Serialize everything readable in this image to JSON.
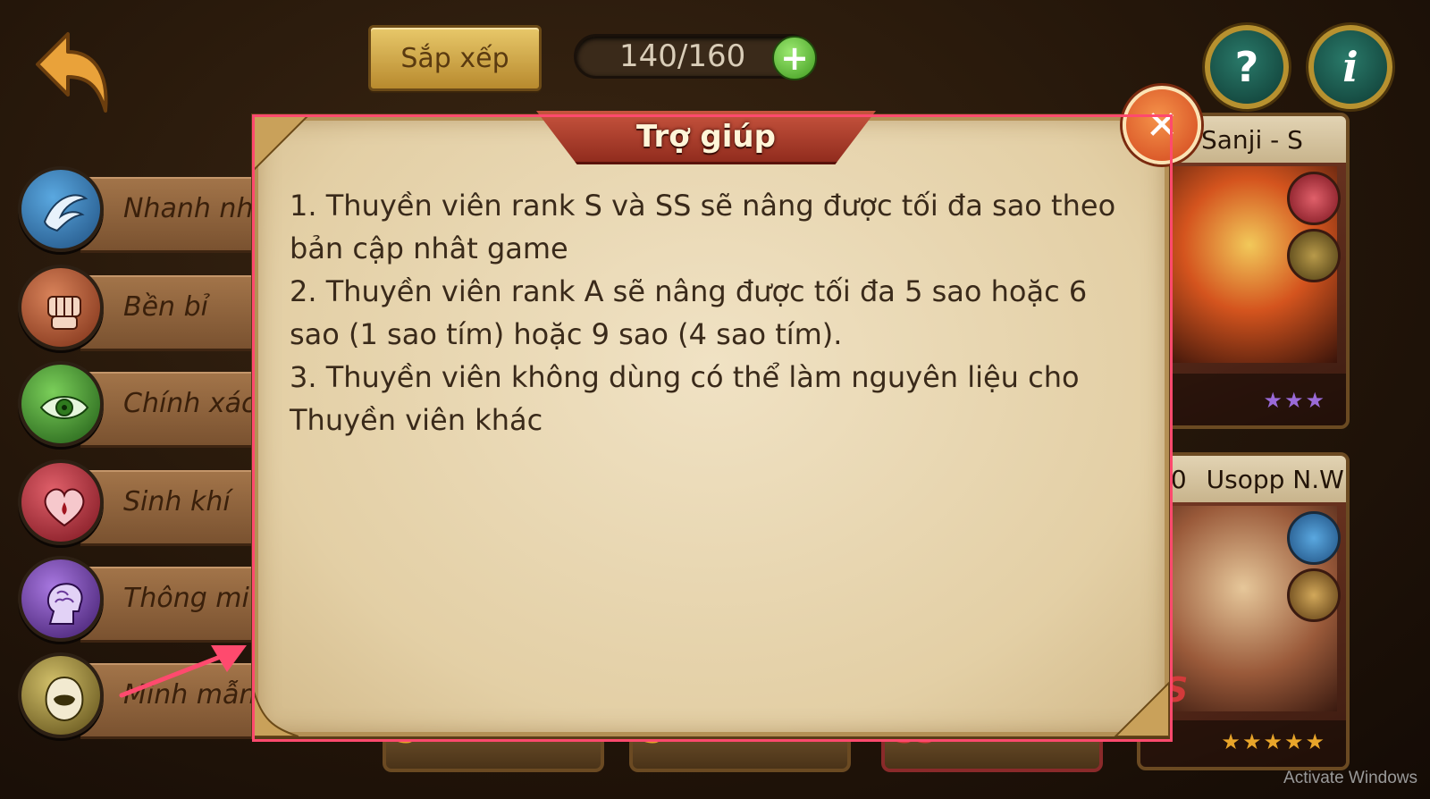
{
  "toolbar": {
    "sort_label": "Sắp xếp",
    "count": "140/160",
    "add_icon": "plus-icon",
    "help_icon": "question-icon",
    "info_icon": "info-icon",
    "back_icon": "back-arrow-icon"
  },
  "sidebar": {
    "items": [
      {
        "label": "Nhanh nh",
        "icon": "wing-icon",
        "color": "#2c6fa8"
      },
      {
        "label": "Bền bỉ",
        "icon": "fist-icon",
        "color": "#a04a2a"
      },
      {
        "label": "Chính xác",
        "icon": "eye-icon",
        "color": "#3a7a2a"
      },
      {
        "label": "Sinh khí",
        "icon": "heart-icon",
        "color": "#a32a34"
      },
      {
        "label": "Thông mi",
        "icon": "brain-icon",
        "color": "#6a3a9a"
      },
      {
        "label": "Minh mẫn",
        "icon": "hooded-figure-icon",
        "color": "#8a7a3a"
      }
    ]
  },
  "cards": [
    {
      "name": "Sanji - S",
      "stars": "★★★",
      "star_color": "#9a6ad8"
    },
    {
      "name": "Usopp N.W",
      "prefix": "00",
      "stars": "★★★★★",
      "star_color": "#e8a52a"
    }
  ],
  "bottom_cards": [
    {
      "rank": "S"
    },
    {
      "rank": "S"
    },
    {
      "rank": "SS"
    },
    {
      "rank": "SS"
    }
  ],
  "dialog": {
    "title": "Trợ giúp",
    "lines": [
      "1. Thuyền viên rank S và SS sẽ nâng được tối đa sao theo bản cập nhât game",
      "2. Thuyền viên rank A sẽ nâng được tối đa 5 sao hoặc 6 sao (1 sao tím) hoặc 9 sao (4 sao tím).",
      "3. Thuyền viên không dùng có thể làm nguyên liệu cho Thuyền viên khác"
    ],
    "close_icon": "close-icon"
  },
  "colors": {
    "highlight": "#ff4a6e",
    "dialog_bg": "#e9d8b3",
    "title_banner": "#b03e2a"
  },
  "watermark": "Activate Windows"
}
